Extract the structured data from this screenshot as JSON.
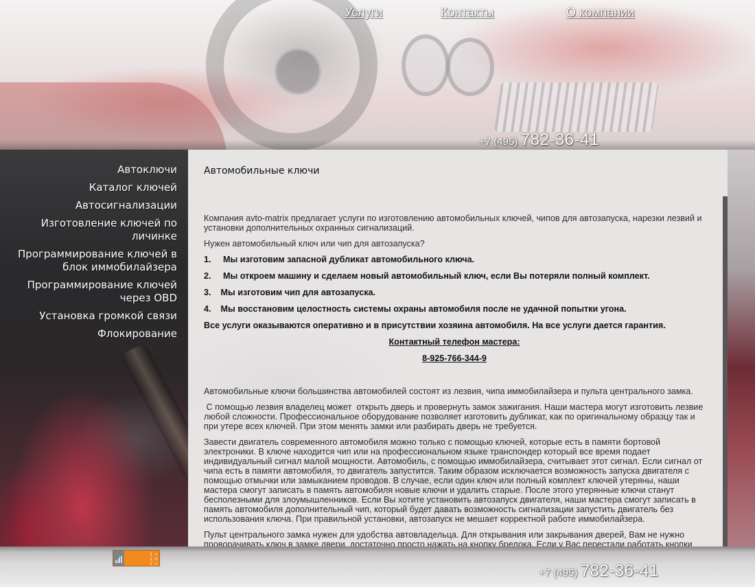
{
  "nav": {
    "items": [
      "Услуги",
      "Контакты",
      "О компании"
    ]
  },
  "phone": {
    "code": "+7 (495)",
    "number": "782-36-41"
  },
  "sidebar": {
    "items": [
      "Автоключи",
      "Каталог ключей",
      "Автосигнализации",
      "Изготовление ключей по личинке",
      "Программирование ключей в блок иммобилайзера",
      "Программирование ключей через OBD",
      "Установка громкой связи",
      "Флокирование"
    ]
  },
  "content": {
    "title": "Автомобильные ключи",
    "intro": "Компания avto-matrix предлагает услуги по изготовлению автомобильных ключей, чипов для автозапуска, нарезки лезвий и установки дополнительных охранных сигнализаций.",
    "question": "Нужен автомобильный ключ или чип для автозапуска?",
    "services": [
      "1.     Мы изготовим запасной дубликат автомобильного ключа.",
      "2.     Мы откроем машину и сделаем новый автомобильный ключ, если Вы потеряли полный комплект.",
      "3.    Мы изготовим чип для автозапуска.",
      "4.    Мы восстановим целостность системы охраны автомобиля после не удачной попытки угона."
    ],
    "guarantee": "Все услуги оказываются оперативно и в присутствии хозяина автомобиля. На все услуги дается гарантия.",
    "contact_label": "Контактный телефон мастера:",
    "contact_phone": "8-925-766-344-9",
    "paragraphs": [
      "Автомобильные ключи большинства автомобилей состоят из лезвия, чипа иммобилайзера и пульта центрального замка.",
      " С помощью лезвия владелец может  открыть дверь и провернуть замок зажигания. Наши мастера могут изготовить лезвие любой сложности. Профессиональное оборудование позволяет изготовить дубликат, как по оригинальному образцу так и при утере всех ключей. При этом менять замки или разбирать дверь не требуется.",
      "Завести двигатель современного автомобиля можно только с помощью ключей, которые есть в памяти бортовой электроники. В ключе находится чип или на профессиональном языке транспондер который все время подает индивидуальный сигнал малой мощности. Автомобиль, с помощью иммобилайзера, считывает этот сигнал. Если сигнал от чипа есть в памяти автомобиля, то двигатель запустится. Таким образом исключается возможность запуска двигателя с помощью отмычки или замыканием проводов. В случае, если один ключ или полный комплект ключей утеряны, наши мастера смогут записать в память автомобиля новые ключи и удалить старые. После этого утерянные ключи станут бесполезными для злоумышленников. Если Вы хотите установить автозапуск двигателя, наши мастера смогут записать в память автомобиля дополнительный чип, который будет давать возможность сигнализации запустить двигатель без использования ключа. При правильной установки, автозапуск не мешает корректной работе иммобилайзера.",
      "Пульт центрального замка нужен для удобства автовладельца. Для открывания или закрывания дверей, Вам не нужно проворачивать  ключ в замке двери, достаточно просто нажать на кнопку брелока.  Если у Вас перестали работать кнопки"
    ]
  },
  "counter": {
    "lines": [
      "1 ↑",
      "1 ⊙",
      "1 ↑"
    ]
  }
}
